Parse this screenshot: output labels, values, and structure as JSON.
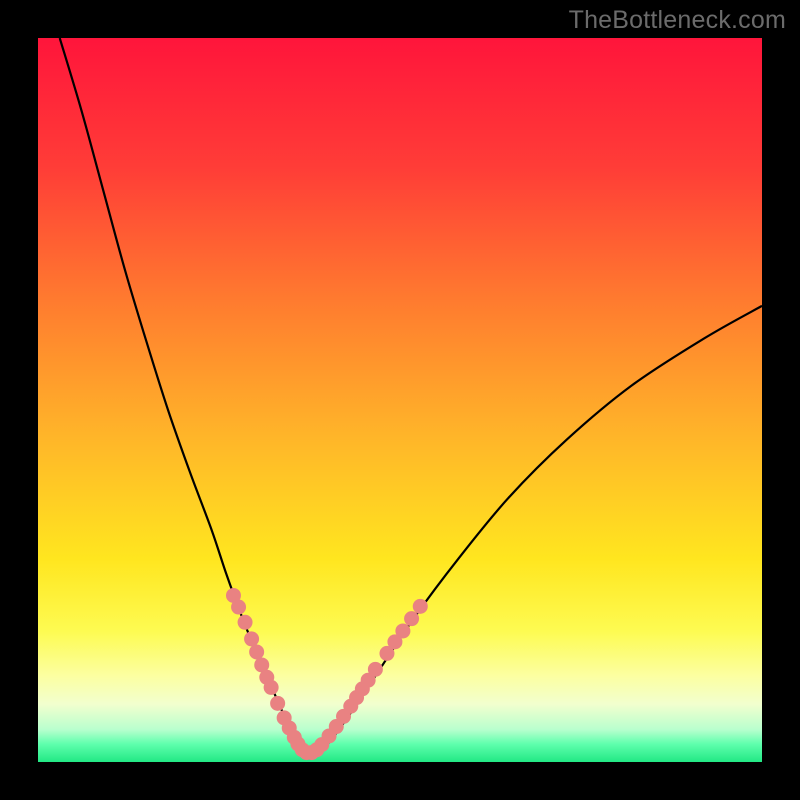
{
  "watermark": "TheBottleneck.com",
  "colors": {
    "black": "#000000",
    "gradient_stops": [
      {
        "offset": 0.0,
        "color": "#ff153b"
      },
      {
        "offset": 0.18,
        "color": "#ff3d37"
      },
      {
        "offset": 0.36,
        "color": "#ff7a2f"
      },
      {
        "offset": 0.55,
        "color": "#ffb529"
      },
      {
        "offset": 0.72,
        "color": "#ffe61f"
      },
      {
        "offset": 0.82,
        "color": "#fdfb52"
      },
      {
        "offset": 0.88,
        "color": "#fcffa0"
      },
      {
        "offset": 0.92,
        "color": "#f2ffce"
      },
      {
        "offset": 0.955,
        "color": "#b9ffce"
      },
      {
        "offset": 0.975,
        "color": "#5fffad"
      },
      {
        "offset": 1.0,
        "color": "#22e884"
      }
    ],
    "curve": "#000000",
    "markers": "#e98282"
  },
  "chart_data": {
    "type": "line",
    "title": "",
    "xlabel": "",
    "ylabel": "",
    "xlim": [
      0,
      100
    ],
    "ylim": [
      0,
      100
    ],
    "grid": false,
    "legend": false,
    "series": [
      {
        "name": "bottleneck-curve",
        "x": [
          3,
          6,
          9,
          12,
          15,
          18,
          21,
          24,
          26,
          28,
          30,
          32,
          33.5,
          35,
          36,
          37,
          38,
          40,
          43,
          47,
          52,
          58,
          65,
          73,
          82,
          92,
          100
        ],
        "y": [
          100,
          90,
          79,
          68,
          58,
          48.5,
          40,
          32,
          26,
          20.5,
          15.5,
          11,
          7.5,
          4.5,
          2.5,
          1.2,
          1.2,
          2.5,
          6.5,
          12.5,
          20,
          28,
          36.5,
          44.5,
          52,
          58.5,
          63
        ]
      }
    ],
    "highlight_clusters": [
      {
        "name": "left-markers",
        "points": [
          {
            "x": 27.0,
            "y": 23.0
          },
          {
            "x": 27.7,
            "y": 21.4
          },
          {
            "x": 28.6,
            "y": 19.3
          },
          {
            "x": 29.5,
            "y": 17.0
          },
          {
            "x": 30.2,
            "y": 15.2
          },
          {
            "x": 30.9,
            "y": 13.4
          },
          {
            "x": 31.6,
            "y": 11.7
          },
          {
            "x": 32.2,
            "y": 10.3
          },
          {
            "x": 33.1,
            "y": 8.1
          },
          {
            "x": 34.0,
            "y": 6.1
          },
          {
            "x": 34.7,
            "y": 4.7
          },
          {
            "x": 35.4,
            "y": 3.4
          }
        ]
      },
      {
        "name": "bottom-markers",
        "points": [
          {
            "x": 35.9,
            "y": 2.5
          },
          {
            "x": 36.5,
            "y": 1.7
          },
          {
            "x": 37.1,
            "y": 1.3
          },
          {
            "x": 37.8,
            "y": 1.3
          },
          {
            "x": 38.5,
            "y": 1.7
          },
          {
            "x": 39.2,
            "y": 2.4
          }
        ]
      },
      {
        "name": "right-markers",
        "points": [
          {
            "x": 40.2,
            "y": 3.6
          },
          {
            "x": 41.2,
            "y": 4.9
          },
          {
            "x": 42.2,
            "y": 6.3
          },
          {
            "x": 43.2,
            "y": 7.7
          },
          {
            "x": 44.0,
            "y": 8.9
          },
          {
            "x": 44.8,
            "y": 10.1
          },
          {
            "x": 45.6,
            "y": 11.3
          },
          {
            "x": 46.6,
            "y": 12.8
          },
          {
            "x": 48.2,
            "y": 15.0
          },
          {
            "x": 49.3,
            "y": 16.6
          },
          {
            "x": 50.4,
            "y": 18.1
          },
          {
            "x": 51.6,
            "y": 19.8
          },
          {
            "x": 52.8,
            "y": 21.5
          }
        ]
      }
    ]
  }
}
